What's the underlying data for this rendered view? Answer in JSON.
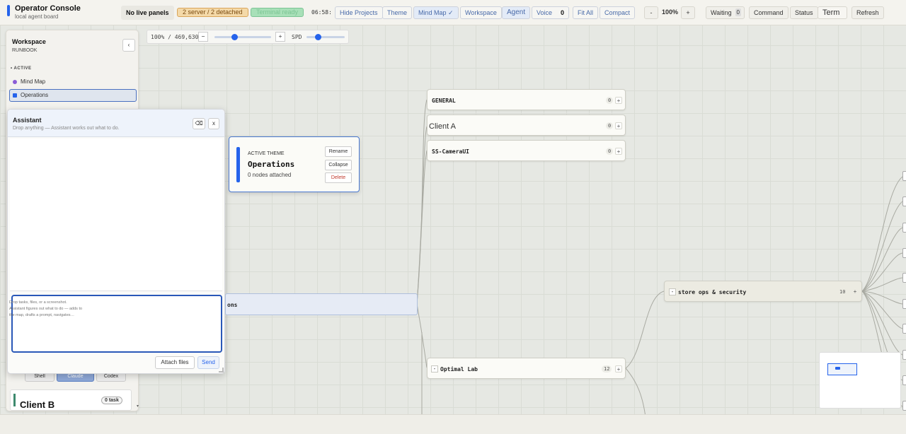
{
  "brand": {
    "title": "Operator Console",
    "subtitle": "local agent board"
  },
  "topbar": {
    "live_panels": "No live panels",
    "server_status": "2 server / 2 detached",
    "terminal_ready": "Terminal ready",
    "clock": "06:58:",
    "hide_projects": "Hide Projects",
    "theme": "Theme",
    "mind_map": "Mind Map ✓",
    "workspace": "Workspace",
    "agent": "Agent",
    "voice": "Voice",
    "voice_count": "0",
    "fit_all": "Fit All",
    "compact": "Compact",
    "zoom_minus": "-",
    "zoom_level": "100%",
    "zoom_plus": "+",
    "waiting": "Waiting",
    "waiting_count": "0",
    "command": "Command",
    "status": "Status",
    "term": "Term",
    "refresh": "Refresh"
  },
  "map_toolbar": {
    "zoom_readout": "100% / 469,630",
    "minus": "−",
    "plus": "+",
    "speed_label": "SPD",
    "zoom_slider": 0.35,
    "speed_slider": 0.3
  },
  "sidebar": {
    "title": "Workspace",
    "subtitle": "RUNBOOK",
    "collapse": "‹",
    "section": "ACTIVE",
    "items": [
      {
        "label": "Mind Map",
        "color": "#8a5cd6"
      },
      {
        "label": "Operations",
        "color": "#2563eb"
      }
    ],
    "tabs": {
      "shell": "Shell",
      "claude": "Claude",
      "codex": "Codex"
    },
    "card": {
      "title": "Client B",
      "badge": "0 task",
      "accent": "#3d8a6e"
    }
  },
  "assistant": {
    "title": "Assistant",
    "subtitle": "Drop anything — Assistant works out what to do.",
    "clear_icon": "⌫",
    "close": "x",
    "placeholder": "Drop tasks, files, or a screenshot. Assistant figures out what to do — adds to the map, drafts a prompt, navigates…",
    "attach": "Attach files",
    "send": "Send"
  },
  "theme_panel": {
    "label": "ACTIVE THEME",
    "name": "Operations",
    "meta": "0 nodes attached",
    "rename": "Rename",
    "collapse": "Collapse",
    "delete": "Delete"
  },
  "nodes": {
    "general": {
      "title": "GENERAL",
      "count": "0"
    },
    "client_a": {
      "title": "Client A",
      "count": "0"
    },
    "camera": {
      "title": "SS-CameraUI",
      "count": "0"
    },
    "operations_partial": "ons",
    "store_ops": {
      "title": "store ops & security",
      "count": "10"
    },
    "optimal_lab": {
      "title": "Optimal Lab",
      "count": "12"
    }
  },
  "colors": {
    "accent": "#2563eb",
    "warning_bg": "#f4d9a8",
    "ready_bg": "#a8e0b8"
  }
}
